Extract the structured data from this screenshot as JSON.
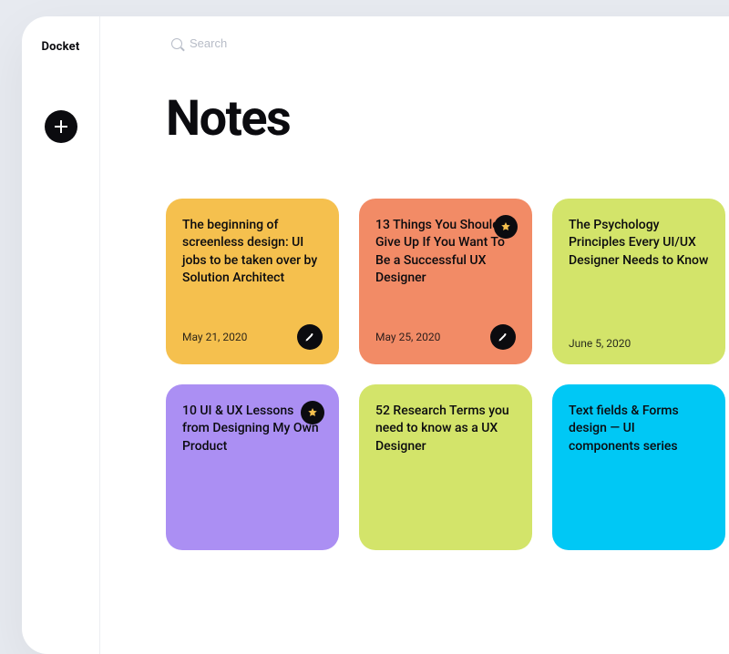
{
  "brand": "Docket",
  "search": {
    "placeholder": "Search"
  },
  "page": {
    "title": "Notes"
  },
  "colors": {
    "yellow": "#f5c04e",
    "orange": "#f28b66",
    "lime": "#d3e46a",
    "purple": "#ab8ff3",
    "cyan": "#00c8f5"
  },
  "cards": [
    {
      "title": "The beginning of screenless design: UI jobs to be taken over by Solution Architect",
      "date": "May 21, 2020",
      "color": "yellow",
      "starred": false,
      "edit": true
    },
    {
      "title": "13 Things You Should Give Up If You Want To Be a Successful UX Designer",
      "date": "May 25, 2020",
      "color": "orange",
      "starred": true,
      "edit": true
    },
    {
      "title": "The Psychology Principles Every UI/UX Designer Needs to Know",
      "date": "June 5, 2020",
      "color": "lime",
      "starred": false,
      "edit": false
    },
    {
      "title": "10 UI & UX Lessons from Designing My Own Product",
      "date": "",
      "color": "purple",
      "starred": true,
      "edit": false
    },
    {
      "title": "52 Research Terms you need to know as a UX Designer",
      "date": "",
      "color": "lime",
      "starred": false,
      "edit": false
    },
    {
      "title": "Text fields & Forms design — UI components series",
      "date": "",
      "color": "cyan",
      "starred": false,
      "edit": false
    }
  ]
}
